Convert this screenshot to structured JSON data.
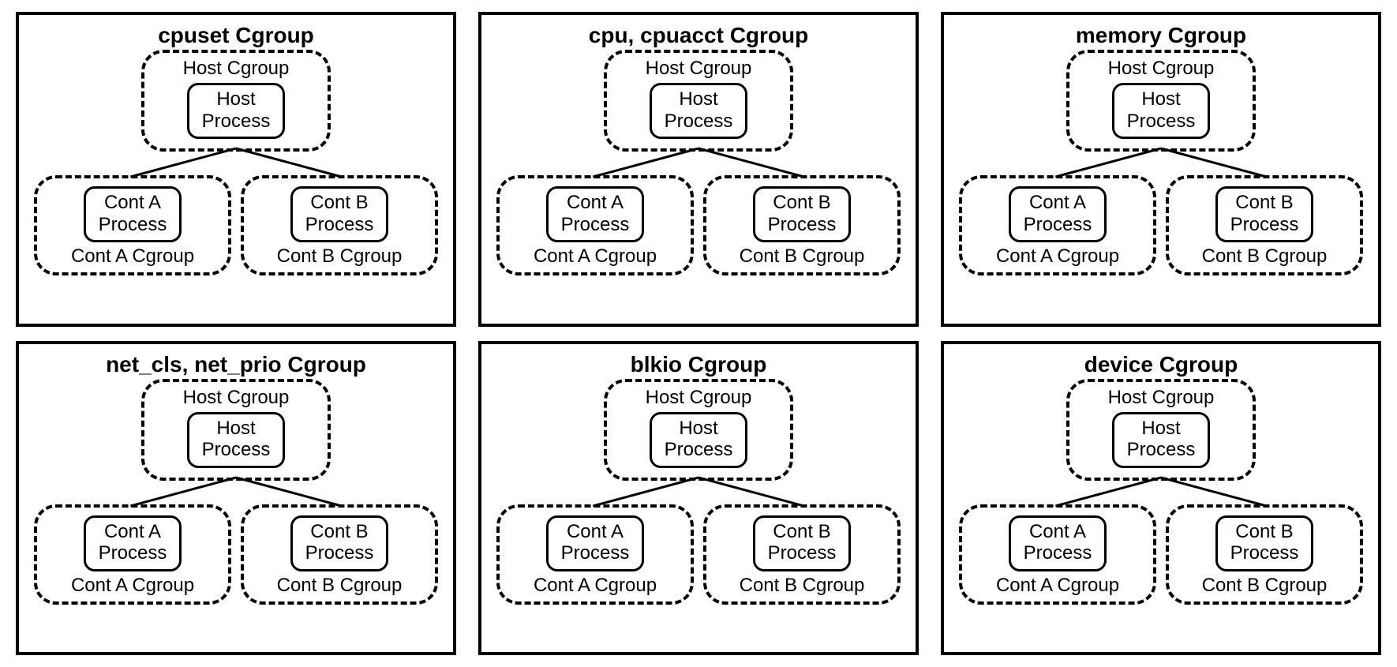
{
  "host_cgroup_label": "Host Cgroup",
  "host_process_l1": "Host",
  "host_process_l2": "Process",
  "cont_a_proc_l1": "Cont A",
  "cont_a_proc_l2": "Process",
  "cont_b_proc_l1": "Cont B",
  "cont_b_proc_l2": "Process",
  "cont_a_cgroup": "Cont A Cgroup",
  "cont_b_cgroup": "Cont B Cgroup",
  "panels": {
    "p0": "cpuset Cgroup",
    "p1": "cpu, cpuacct Cgroup",
    "p2": "memory Cgroup",
    "p3": "net_cls, net_prio Cgroup",
    "p4": "blkio Cgroup",
    "p5": "device Cgroup"
  }
}
